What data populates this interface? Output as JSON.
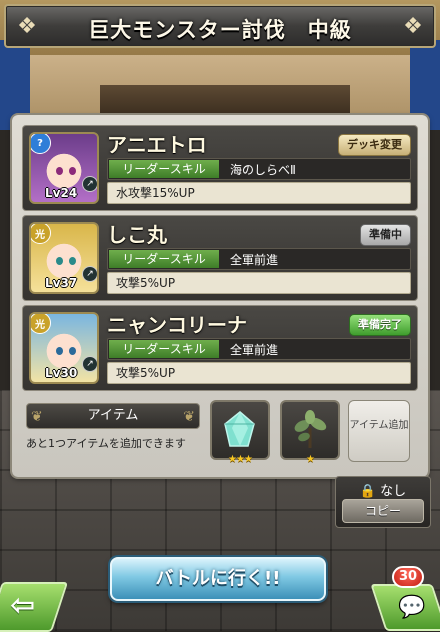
{
  "header": {
    "title": "巨大モンスター討伐　中級"
  },
  "party": [
    {
      "name": "アニエトロ",
      "level": "Lv24",
      "element": "water",
      "status": "デッキ変更",
      "skill_label": "リーダースキル",
      "skill_name": "海のしらべⅡ",
      "skill_desc": "水攻撃15%UP",
      "hair_color": "#7b3a8f"
    },
    {
      "name": "しこ丸",
      "level": "Lv37",
      "element": "light",
      "status": "準備中",
      "skill_label": "リーダースキル",
      "skill_name": "全軍前進",
      "skill_desc": "攻撃5%UP",
      "hair_color": "#e7c14d"
    },
    {
      "name": "ニャンコリーナ",
      "level": "Lv30",
      "element": "light",
      "status": "準備完了",
      "skill_label": "リーダースキル",
      "skill_name": "全軍前進",
      "skill_desc": "攻撃5%UP",
      "hair_color": "#e7c14d"
    }
  ],
  "items": {
    "header": "アイテム",
    "note": "あと1つアイテムを追加できます",
    "slots": [
      {
        "icon": "crystal-icon",
        "stars": "★★★"
      },
      {
        "icon": "plant-icon",
        "stars": "★"
      }
    ],
    "add_label": "アイテム追加"
  },
  "lock": {
    "label": "なし",
    "copy_label": "コピー"
  },
  "battle_button": "バトルに行く!!",
  "chat": {
    "count": "30"
  },
  "colors": {
    "accent_green": "#3f9d2d",
    "battle_blue": "#7fc8e3",
    "water_badge": "#2f7ed8",
    "light_badge": "#c9a22a"
  }
}
